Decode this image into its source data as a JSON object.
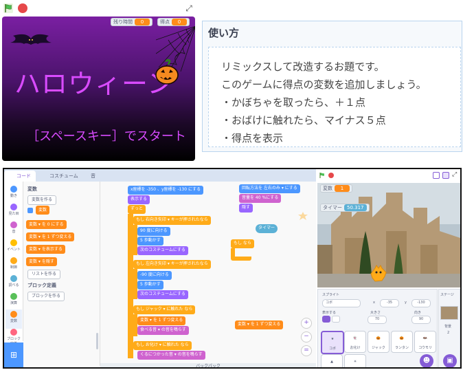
{
  "game": {
    "monitors": [
      {
        "label": "残り時間",
        "value": "0"
      },
      {
        "label": "得点",
        "value": "0"
      }
    ],
    "title": "ハロウィーン",
    "start": "［スペースキー］でスタート"
  },
  "instructions": {
    "heading": "使い方",
    "lines": [
      "リミックスして改造するお題です。",
      "このゲームに得点の変数を追加しましょう。",
      "・かぼちゃを取ったら、＋１点",
      "・おばけに触れたら、マイナス５点",
      "・得点を表示"
    ]
  },
  "editor": {
    "tabs": [
      "コード",
      "コスチューム",
      "音"
    ],
    "categories": [
      {
        "label": "動き",
        "color": "#4c97ff"
      },
      {
        "label": "見た目",
        "color": "#9966ff"
      },
      {
        "label": "音",
        "color": "#cf63cf"
      },
      {
        "label": "イベント",
        "color": "#ffbf00"
      },
      {
        "label": "制御",
        "color": "#ffab19"
      },
      {
        "label": "調べる",
        "color": "#5cb1d6"
      },
      {
        "label": "演算",
        "color": "#59c059"
      },
      {
        "label": "変数",
        "color": "#ff8c1a"
      },
      {
        "label": "ブロック定義",
        "color": "#ff6680"
      }
    ],
    "palette": {
      "heading": "変数",
      "make_var": "変数を作る",
      "var_name": "変数",
      "set_block": "変数 ▾ を 0 にする",
      "change_block": "変数 ▾ を 1 ずつ変える",
      "show_block": "変数 ▾ を表示する",
      "hide_block": "変数 ▾ を隠す",
      "make_list": "リストを作る",
      "myblocks_heading": "ブロック定義",
      "make_block": "ブロックを作る"
    },
    "scripts": {
      "s1": [
        "x座標を -350 、y座標を -130 にする",
        "表示する",
        "ずっと",
        "もし 右向き矢印 ▾ キーが押されたなら",
        "90 度に向ける",
        "5 歩動かす",
        "次のコスチュームにする",
        "もし 左向き矢印 ▾ キーが押されたなら",
        "-90 度に向ける",
        "5 歩動かす",
        "次のコスチュームにする",
        "もし ジャック ▾ に触れた なら",
        "変数 ▾ を 1 ずつ変える",
        "食べる音 ▾ の音を鳴らす",
        "もし お化け ▾ に触れた なら",
        "くるにつかった音 ▾ の音を鳴らす"
      ],
      "s2": [
        "回転方法を 左右のみ ▾ にする",
        "音量を 40 %にする",
        "隠す"
      ],
      "timer_reporter": "タイマー",
      "if_empty": "もし  なら",
      "loose_change": "変数 ▾ を 1 ずつ変える"
    },
    "zoom": [
      "+",
      "−",
      "="
    ],
    "backpack": "バックパック"
  },
  "stage_panel": {
    "monitors": [
      {
        "label": "変数",
        "value": "1"
      },
      {
        "label": "タイマー",
        "value": "50.317"
      }
    ],
    "sprite_label": "スプライト",
    "sprite_name": "コボ",
    "x_label": "x",
    "x_value": "-35",
    "y_label": "y",
    "y_value": "-130",
    "show_label": "表示する",
    "size_label": "大きさ",
    "size_value": "70",
    "dir_label": "向き",
    "dir_value": "90",
    "sprites": [
      "コボ",
      "お化け",
      "ジャック",
      "ランタン",
      "コウモリ"
    ],
    "stage_label": "ステージ",
    "backdrop_label": "背景",
    "backdrop_count": "2"
  }
}
